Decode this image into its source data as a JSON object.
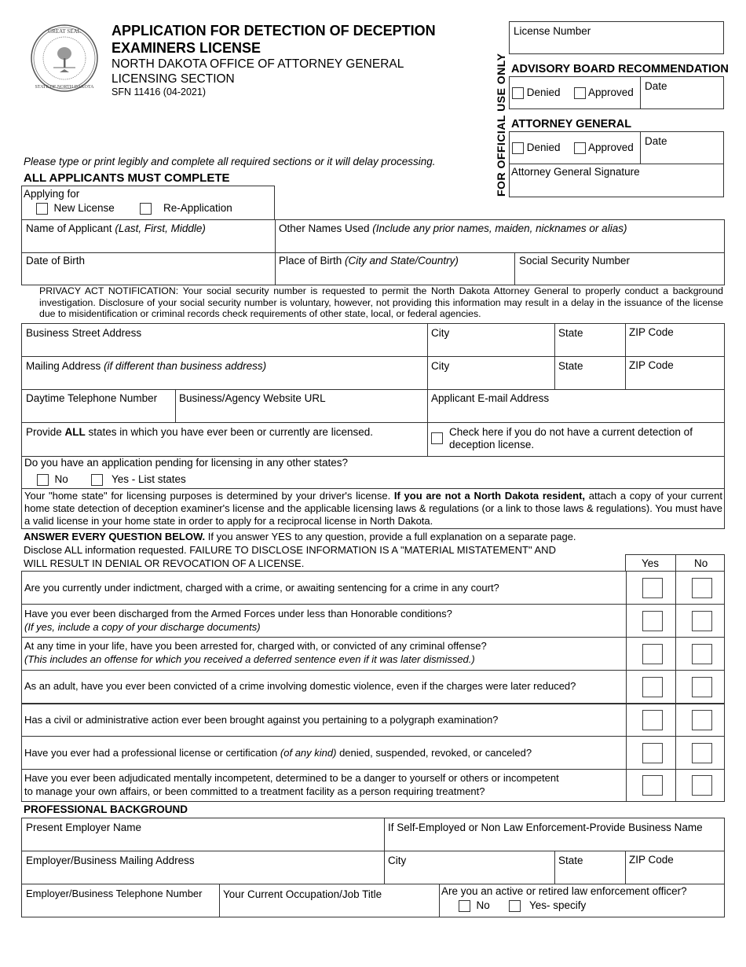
{
  "header": {
    "title_line1": "APPLICATION FOR DETECTION OF DECEPTION",
    "title_line2": "EXAMINERS LICENSE",
    "agency": "NORTH DAKOTA OFFICE OF ATTORNEY GENERAL",
    "section": "LICENSING SECTION",
    "form_number": "SFN 11416 (04-2021)",
    "seal_top_text": "GREAT SEAL",
    "seal_bottom_text": "STATE OF NORTH DAKOTA"
  },
  "official_use": {
    "vertical_label": "FOR OFFICIAL USE ONLY",
    "license_number_label": "License Number",
    "advisory_heading": "ADVISORY BOARD RECOMMENDATION",
    "ag_heading": "ATTORNEY GENERAL",
    "denied_label": "Denied",
    "approved_label": "Approved",
    "date_label": "Date",
    "ag_signature_label": "Attorney General Signature"
  },
  "instructions": "Please type or print legibly and complete all required sections or it will delay processing.",
  "all_applicants_heading": "ALL APPLICANTS MUST COMPLETE",
  "applying_for": {
    "label": "Applying for",
    "options": [
      "New License",
      "Re-Application"
    ]
  },
  "personal": {
    "name_label": "Name of Applicant ",
    "name_hint": "(Last, First, Middle)",
    "other_names_label": "Other Names Used ",
    "other_names_hint": "(Include any prior names, maiden, nicknames or alias)",
    "dob_label": "Date of Birth",
    "pob_label": "Place of Birth ",
    "pob_hint": "(City and State/Country)",
    "ssn_label": "Social Security Number"
  },
  "privacy_notice": "PRIVACY ACT NOTIFICATION: Your social security number is requested to permit the North Dakota Attorney General to properly conduct a background investigation. Disclosure of your social security number is voluntary, however, not providing this information may result in a delay in the issuance of the license due to misidentification or criminal records check requirements of other state, local, or federal agencies.",
  "address": {
    "business_street_label": "Business Street Address",
    "mailing_label": "Mailing Address ",
    "mailing_hint": "(if different than business address)",
    "city_label": "City",
    "state_label": "State",
    "zip_label": "ZIP Code",
    "phone_label": "Daytime Telephone Number",
    "website_label": "Business/Agency Website URL",
    "email_label": "Applicant E-mail Address"
  },
  "licensed_states": {
    "label_pre": "Provide ",
    "label_bold": "ALL",
    "label_post": " states in which you have ever been or currently are licensed.",
    "no_license_check": "Check here if you do not have a current detection of deception license."
  },
  "pending": {
    "question": "Do you have an application pending for licensing in any other states?",
    "options": [
      "No",
      "Yes - List states"
    ]
  },
  "home_state_notice": {
    "part1": "Your \"home state\" for licensing purposes is determined by your driver's license. ",
    "bold": "If you are not a North Dakota resident,",
    "part2": " attach a copy of your current home state detection of deception examiner's license and the applicable licensing laws & regulations (or a link to those laws & regulations). You must have a valid license in your home state in order to apply for a reciprocal license in North Dakota."
  },
  "questions_intro": {
    "bold": "ANSWER EVERY QUESTION BELOW.",
    "line1_rest": " If you answer YES to any question, provide a full explanation on a separate page.",
    "line2": "Disclose ALL information requested. FAILURE TO DISCLOSE INFORMATION IS A \"MATERIAL MISTATEMENT\" AND",
    "line3": "WILL RESULT IN DENIAL OR REVOCATION OF A LICENSE.",
    "yes_header": "Yes",
    "no_header": "No"
  },
  "questions": [
    {
      "line1": "Are you currently under indictment, charged with a crime, or awaiting sentencing for a crime in any court?",
      "line2": ""
    },
    {
      "line1": "Have you ever been discharged from the Armed Forces under less than Honorable conditions?",
      "line2": "(If yes, include a copy of your discharge documents)"
    },
    {
      "line1": "At any time in your life, have you been arrested for, charged with, or convicted of any criminal offense?",
      "line2": "(This includes an offense for which you received a deferred sentence even if it was later dismissed.)"
    },
    {
      "line1": "As an adult, have you ever been convicted of a crime involving domestic violence, even if the charges were later reduced?",
      "line2": ""
    },
    {
      "line1": "Has a civil or administrative action ever been brought against you pertaining to a polygraph examination?",
      "line2": ""
    },
    {
      "line1_pre": "Have you ever had a professional license or certification ",
      "line1_it": "(of any kind)",
      "line1_post": " denied, suspended, revoked, or canceled?"
    },
    {
      "line1": "Have you ever been adjudicated mentally incompetent, determined to be a danger to yourself or others or incompetent",
      "line2": "to manage your own affairs, or been committed to a treatment facility as a person requiring treatment?"
    }
  ],
  "professional": {
    "heading": "PROFESSIONAL BACKGROUND",
    "employer_name_label": "Present Employer Name",
    "self_employed_label": "If Self-Employed or Non Law Enforcement-Provide Business Name",
    "employer_address_label": "Employer/Business Mailing Address",
    "city_label": "City",
    "state_label": "State",
    "zip_label": "ZIP Code",
    "employer_phone_label": "Employer/Business Telephone Number",
    "occupation_label": "Your Current Occupation/Job Title",
    "le_officer_question": "Are you an active or retired law enforcement officer?",
    "le_options": [
      "No",
      "Yes- specify"
    ]
  }
}
